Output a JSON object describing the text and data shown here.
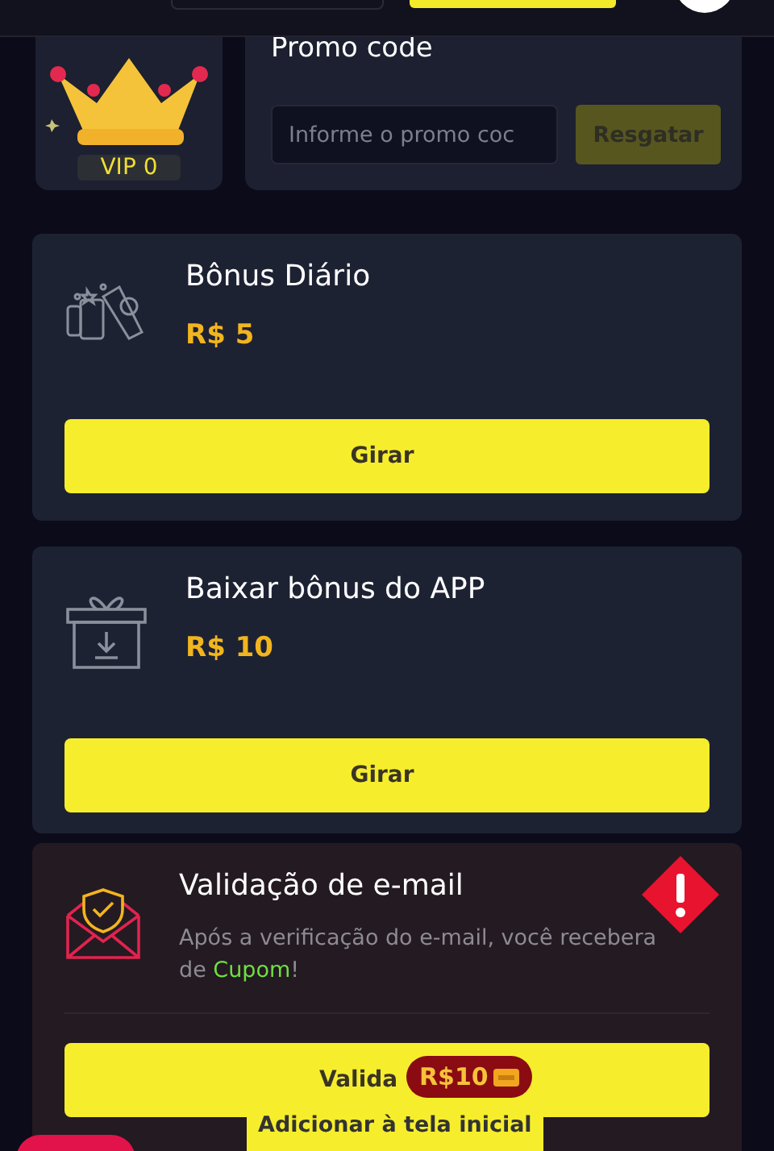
{
  "vip": {
    "label": "VIP 0"
  },
  "promo": {
    "title": "Promo code",
    "placeholder": "Informe o promo coc",
    "button": {
      "label": "Resgatar",
      "disabled": true
    }
  },
  "cards": [
    {
      "kind": "daily",
      "title": "Bônus Diário",
      "amount": "R$ 5",
      "button": "Girar"
    },
    {
      "kind": "app",
      "title": "Baixar bônus do APP",
      "amount": "R$ 10",
      "button": "Girar"
    },
    {
      "kind": "email",
      "title": "Validação de e-mail",
      "alert": true,
      "description": [
        {
          "text": "Após a verificação do e-mail, você recebera de ",
          "highlight": false
        },
        {
          "text": "Cupom",
          "highlight": true
        },
        {
          "text": "!",
          "highlight": false
        }
      ],
      "button": "Valida"
    }
  ],
  "badge": {
    "amount": "R$10"
  },
  "tooltip": {
    "text": "Adicionar à tela inicial"
  }
}
